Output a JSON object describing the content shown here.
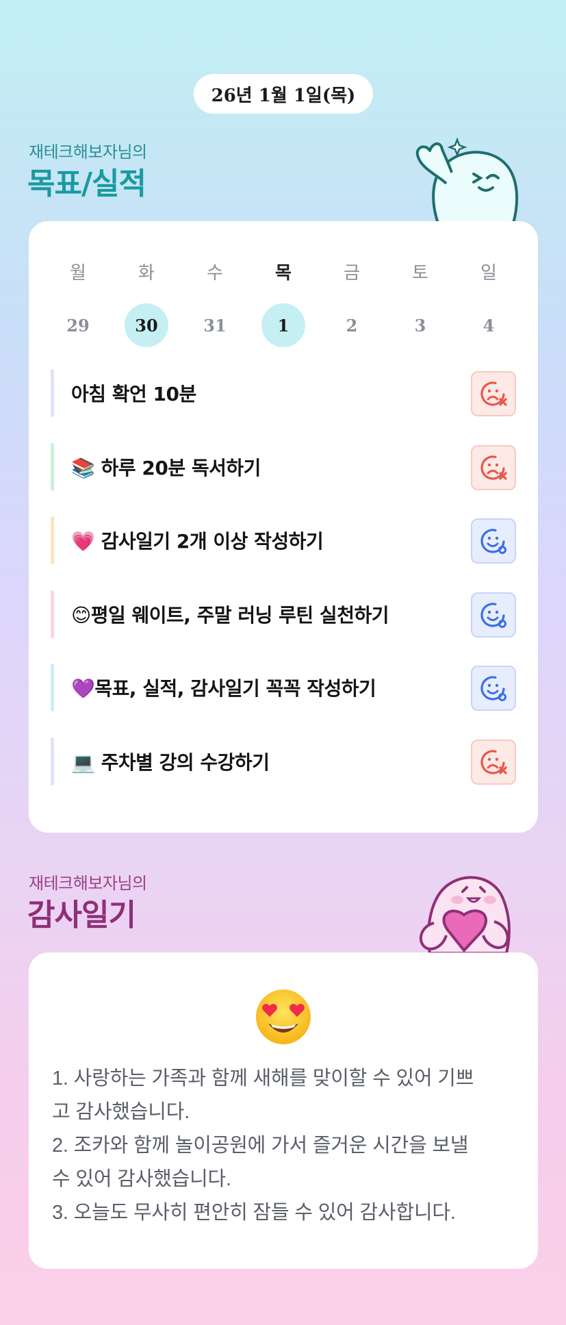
{
  "header": {
    "date": "26년 1월 1일(목)"
  },
  "goals_section": {
    "owner_label": "재테크해보자님의",
    "title": "목표/실적"
  },
  "week": {
    "days": [
      {
        "label": "월",
        "date": "29",
        "today": false,
        "selected": false
      },
      {
        "label": "화",
        "date": "30",
        "today": false,
        "selected": true
      },
      {
        "label": "수",
        "date": "31",
        "today": false,
        "selected": false
      },
      {
        "label": "목",
        "date": "1",
        "today": true,
        "selected": true
      },
      {
        "label": "금",
        "date": "2",
        "today": false,
        "selected": false
      },
      {
        "label": "토",
        "date": "3",
        "today": false,
        "selected": false
      },
      {
        "label": "일",
        "date": "4",
        "today": false,
        "selected": false
      }
    ]
  },
  "goals": [
    {
      "text": "아침 확언 10분",
      "status": "fail",
      "bar_color": "#dfe3fb"
    },
    {
      "text": "📚 하루 20분 독서하기",
      "status": "fail",
      "bar_color": "#c9f0d8"
    },
    {
      "text": "💗 감사일기 2개 이상 작성하기",
      "status": "done",
      "bar_color": "#fde2c4"
    },
    {
      "text": "😊평일 웨이트, 주말 러닝 루틴 실천하기",
      "status": "done",
      "bar_color": "#fbd3e6"
    },
    {
      "text": "💜목표, 실적, 감사일기 꼭꼭 작성하기",
      "status": "done",
      "bar_color": "#cdeef6"
    },
    {
      "text": "💻 주차별 강의 수강하기",
      "status": "fail",
      "bar_color": "#dfe3fb"
    }
  ],
  "status_icons": {
    "fail": "sad-face-x-icon",
    "done": "smile-face-check-icon"
  },
  "gratitude_section": {
    "owner_label": "재테크해보자님의",
    "title": "감사일기"
  },
  "gratitude": {
    "mood_icon": "heart-eyes-emoji-icon",
    "lines": [
      "1. 사랑하는 가족과 함께 새해를 맞이할 수 있어 기쁘",
      "고 감사했습니다.",
      "2. 조카와 함께 놀이공원에 가서 즐거운 시간을 보낼",
      "수 있어 감사했습니다.",
      "3. 오늘도 무사히 편안히 잠들 수 있어 감사합니다."
    ]
  },
  "colors": {
    "fail_icon": "#e8574a",
    "done_icon": "#3b6ee6",
    "goal_title": "#1a9aa2",
    "gratitude_title": "#8f2f78"
  }
}
